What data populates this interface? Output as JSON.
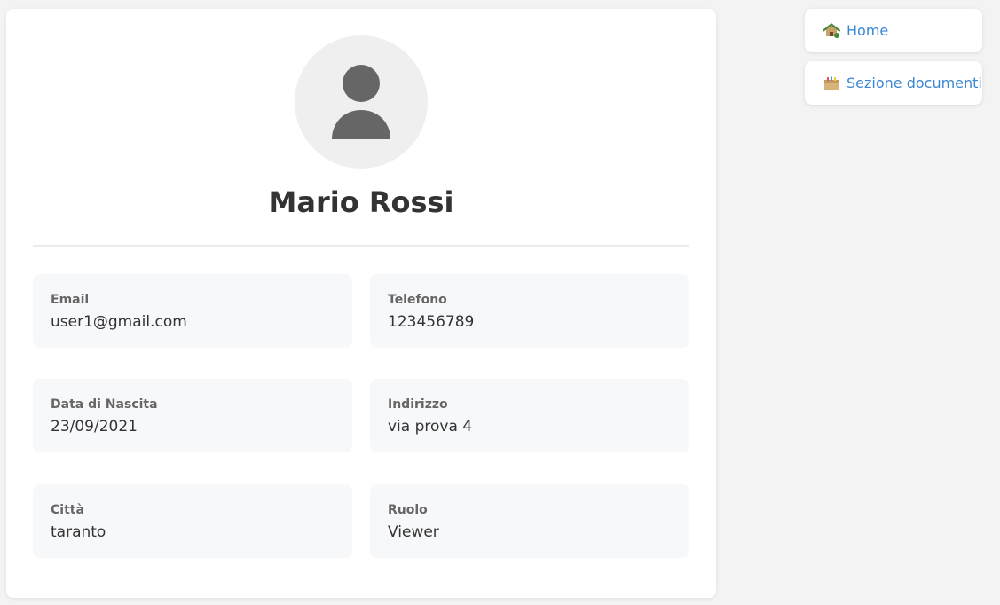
{
  "profile": {
    "name": "Mario Rossi",
    "avatar_icon": "user-silhouette-icon"
  },
  "fields": {
    "email": {
      "label": "Email",
      "value": "user1@gmail.com"
    },
    "phone": {
      "label": "Telefono",
      "value": "123456789"
    },
    "birthdate": {
      "label": "Data di Nascita",
      "value": "23/09/2021"
    },
    "address": {
      "label": "Indirizzo",
      "value": "via prova 4"
    },
    "city": {
      "label": "Città",
      "value": "taranto"
    },
    "role": {
      "label": "Ruolo",
      "value": "Viewer"
    }
  },
  "nav": {
    "home": {
      "label": "Home",
      "icon": "house-icon"
    },
    "documents": {
      "label": "Sezione documenti",
      "icon": "card-box-icon"
    }
  },
  "colors": {
    "link": "#3a87d4",
    "background": "#f3f3f3",
    "card": "#ffffff",
    "field_bg": "#f7f8fa"
  }
}
